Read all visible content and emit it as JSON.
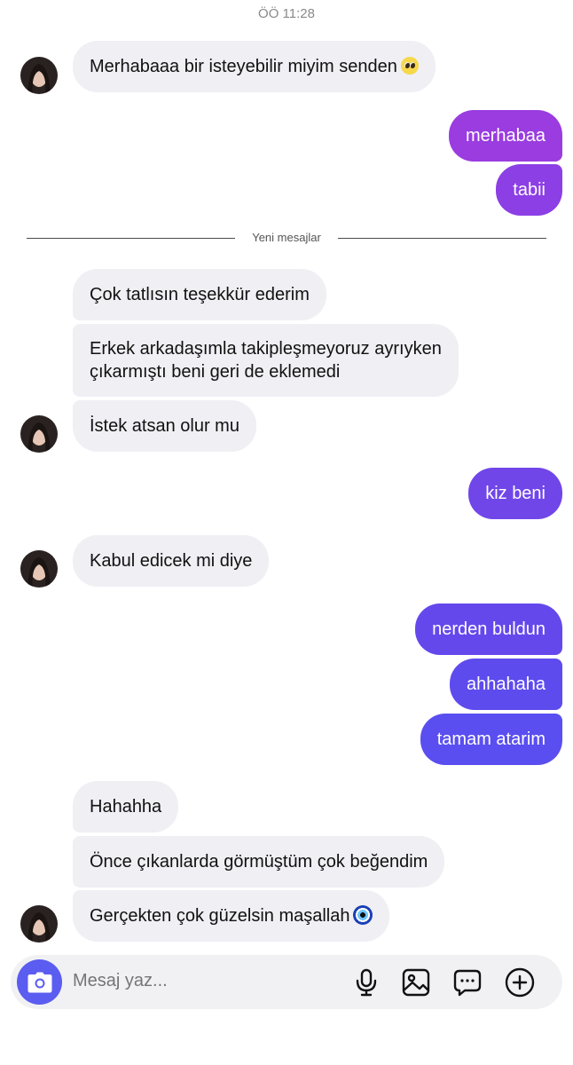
{
  "status": {
    "time": "ÖÖ 11:28"
  },
  "divider": {
    "label": "Yeni mesajlar"
  },
  "messages": {
    "m1": "Merhabaaa bir isteyebilir miyim senden",
    "m2": "merhabaa",
    "m3": "tabii",
    "m4": "Çok tatlısın teşekkür ederim",
    "m5_line1": "Erkek arkadaşımla takipleşmeyoruz ayrıyken",
    "m5_line2": "çıkarmıştı beni geri de eklemedi",
    "m6": "İstek atsan olur mu",
    "m7": "kiz beni",
    "m8": "Kabul edicek mi diye",
    "m9": "nerden buldun",
    "m10": "ahhahaha",
    "m11": "tamam atarim",
    "m12": "Hahahha",
    "m13": "Önce çıkanlarda görmüştüm çok beğendim",
    "m14": "Gerçekten çok güzelsin maşallah"
  },
  "emojis": {
    "m1": "pleading-face",
    "m14": "nazar-amulet"
  },
  "composer": {
    "placeholder": "Mesaj yaz...",
    "icons": [
      "camera-icon",
      "microphone-icon",
      "image-icon",
      "sticker-icon",
      "add-icon"
    ]
  },
  "colors": {
    "sent_top": "#9a3ce0",
    "sent_mid": "#7844ea",
    "sent_bottom": "#5b4ff0",
    "received": "#efeff4",
    "camera": "#5b5cf0"
  }
}
